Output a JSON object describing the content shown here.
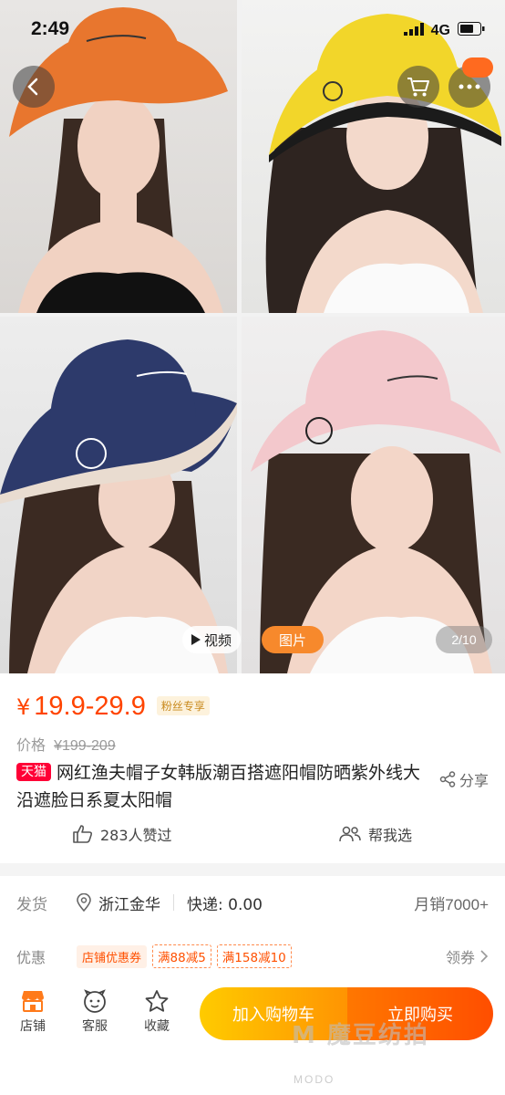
{
  "status_bar": {
    "time": "2:49",
    "network": "4G"
  },
  "gallery": {
    "video_label": "视频",
    "photo_label": "图片",
    "counter": "2/10",
    "hat_colors": [
      "#e8762e",
      "#f2d62a",
      "#2d3a6b",
      "#f3c8cc"
    ]
  },
  "price": {
    "symbol": "¥",
    "range": "19.9-29.9",
    "fan_tag": "粉丝专享",
    "original_label": "价格",
    "original_price": "¥199-209"
  },
  "product": {
    "badge": "天猫",
    "title": "网红渔夫帽子女韩版潮百搭遮阳帽防晒紫外线大沿遮脸日系夏太阳帽",
    "share_label": "分享",
    "likes": "283人赞过",
    "help_choose": "帮我选"
  },
  "shipping": {
    "label": "发货",
    "location": "浙江金华",
    "express": "快递: 0.00",
    "monthly_sales": "月销7000+"
  },
  "promo": {
    "label": "优惠",
    "shop_coupon": "店铺优惠券",
    "coupons": [
      "满88减5",
      "满158减10"
    ],
    "claim": "领券"
  },
  "bottom_bar": {
    "shop": "店铺",
    "service": "客服",
    "favorite": "收藏",
    "add_to_cart": "加入购物车",
    "buy_now": "立即购买"
  },
  "watermark": {
    "text": "M 魔豆纺拍",
    "sub": "MODO"
  },
  "colors": {
    "accent": "#ff4400",
    "tmall": "#ff0036",
    "cart_btn": "#ff9402",
    "buy_btn": "#ff5000"
  }
}
